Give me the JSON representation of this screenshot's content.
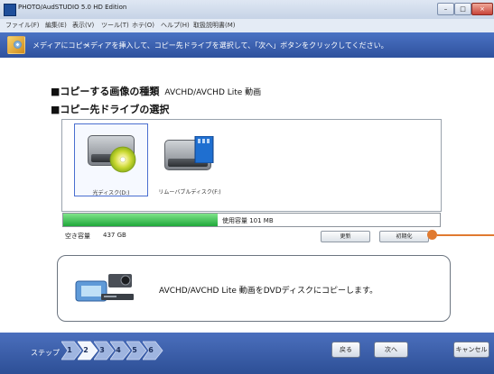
{
  "window": {
    "title": "PHOTO/AudSTUDIO 5.0 HD Edition",
    "min_glyph": "–",
    "max_glyph": "□",
    "close_glyph": "×"
  },
  "menu": [
    {
      "label": "ファイル(F)"
    },
    {
      "label": "編集(E)"
    },
    {
      "label": "表示(V)"
    },
    {
      "label": "ツール(T)"
    },
    {
      "label": "ホテ(O)"
    },
    {
      "label": "ヘルプ(H)"
    },
    {
      "label": "取扱説明書(M)"
    }
  ],
  "banner": {
    "step_title": "メディアにコピー",
    "instruction": "メディアを挿入して、コピー先ドライブを選択して、「次へ」ボタンをクリックしてください。"
  },
  "content": {
    "heading1_prefix": "■コピーする画像の種類",
    "heading1_value": "AVCHD/AVCHD Lite 動画",
    "heading2": "■コピー先ドライブの選択"
  },
  "drives": [
    {
      "label": "光ディスク(D:)",
      "selected": true,
      "icon": "optical-drive-icon"
    },
    {
      "label": "リムーバブルディスク(F:)",
      "selected": false,
      "icon": "removable-disk-icon"
    }
  ],
  "capacity": {
    "used_label": "使用容量 101 MB",
    "used_fraction": 0.41,
    "free_label": "空き容量",
    "free_value": "437 GB",
    "fill_color": "#1fa83a"
  },
  "buttons": {
    "refresh": "更新",
    "initialize": "初期化",
    "back": "戻る",
    "next": "次へ",
    "cancel": "キャンセル"
  },
  "message": {
    "text": "AVCHD/AVCHD Lite 動画をDVDディスクにコピーします。",
    "icon": "camera-to-disc-icon"
  },
  "steps": {
    "label": "ステップ",
    "items": [
      "1",
      "2",
      "3",
      "4",
      "5",
      "6"
    ],
    "current": 2
  },
  "colors": {
    "banner": "#3a5fae",
    "accent_callout": "#e07a30",
    "selection_border": "#4a6fd0"
  }
}
